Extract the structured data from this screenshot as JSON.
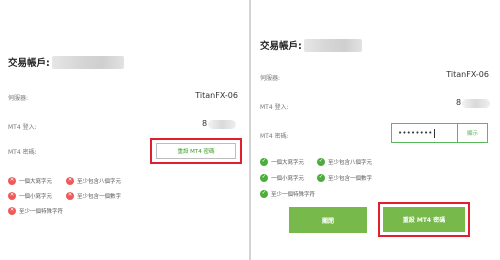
{
  "left_panel": {
    "title": "交易帳戶:",
    "server_label": "伺服器:",
    "server_value": "TitanFX-06",
    "login_label": "MT4 登入:",
    "login_value": "8",
    "password_label": "MT4 密碼:",
    "reset_button_label": "重設 MT4 密碼",
    "rules": [
      {
        "text": "一個大寫字元",
        "status": "fail",
        "icon": "x-icon"
      },
      {
        "text": "至少包含八個字元",
        "status": "fail",
        "icon": "x-icon"
      },
      {
        "text": "一個小寫字元",
        "status": "fail",
        "icon": "x-icon"
      },
      {
        "text": "至少包含一個數字",
        "status": "fail",
        "icon": "x-icon"
      },
      {
        "text": "至少一個特殊字符",
        "status": "fail",
        "icon": "x-icon"
      }
    ]
  },
  "right_panel": {
    "title": "交易帳戶:",
    "server_label": "伺服器:",
    "server_value": "TitanFX-06",
    "login_label": "MT4 登入:",
    "login_value": "8",
    "password_label": "MT4 密碼:",
    "password_value": "••••••••",
    "show_button_label": "顯示",
    "rules": [
      {
        "text": "一個大寫字元",
        "status": "pass",
        "icon": "check-icon"
      },
      {
        "text": "至少包含八個字元",
        "status": "pass",
        "icon": "check-icon"
      },
      {
        "text": "一個小寫字元",
        "status": "pass",
        "icon": "check-icon"
      },
      {
        "text": "至少包含一個數字",
        "status": "pass",
        "icon": "check-icon"
      },
      {
        "text": "至少一個特殊字符",
        "status": "pass",
        "icon": "check-icon"
      }
    ],
    "close_button_label": "關閉",
    "reset_button_label": "重設 MT4 密碼"
  },
  "colors": {
    "highlight": "#e0202e",
    "accent_green": "#77b94b",
    "fail_red": "#ee5a5a",
    "pass_green": "#4cae3a"
  }
}
